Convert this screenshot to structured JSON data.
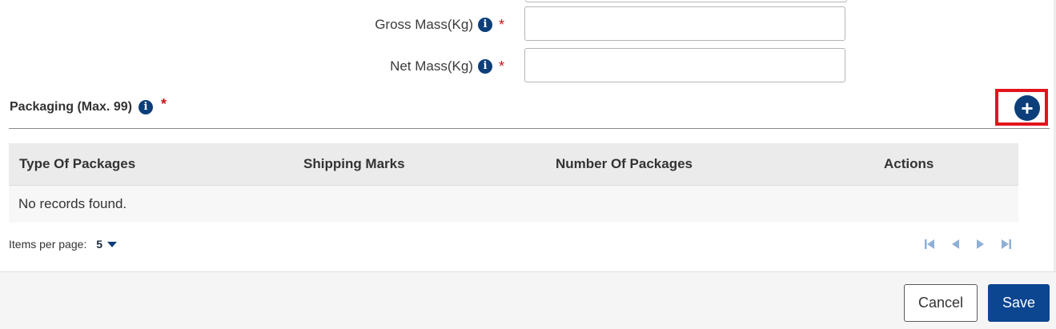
{
  "form": {
    "gross_mass": {
      "label": "Gross Mass(Kg)",
      "required_mark": "*",
      "value": ""
    },
    "net_mass": {
      "label": "Net Mass(Kg)",
      "required_mark": "*",
      "value": ""
    }
  },
  "packaging": {
    "title": "Packaging (Max. 99)",
    "required_mark": "*",
    "add_icon": "plus-circle-icon",
    "table": {
      "columns": [
        "Type Of Packages",
        "Shipping Marks",
        "Number Of Packages",
        "Actions"
      ],
      "empty_message": "No records found."
    },
    "pagination": {
      "items_per_page_label": "Items per page:",
      "items_per_page_value": "5"
    }
  },
  "footer": {
    "cancel_label": "Cancel",
    "save_label": "Save"
  },
  "colors": {
    "accent": "#0c3f7a",
    "required": "#c9151e",
    "highlight": "#e3141c",
    "pager_disabled": "#8fb0d6"
  }
}
